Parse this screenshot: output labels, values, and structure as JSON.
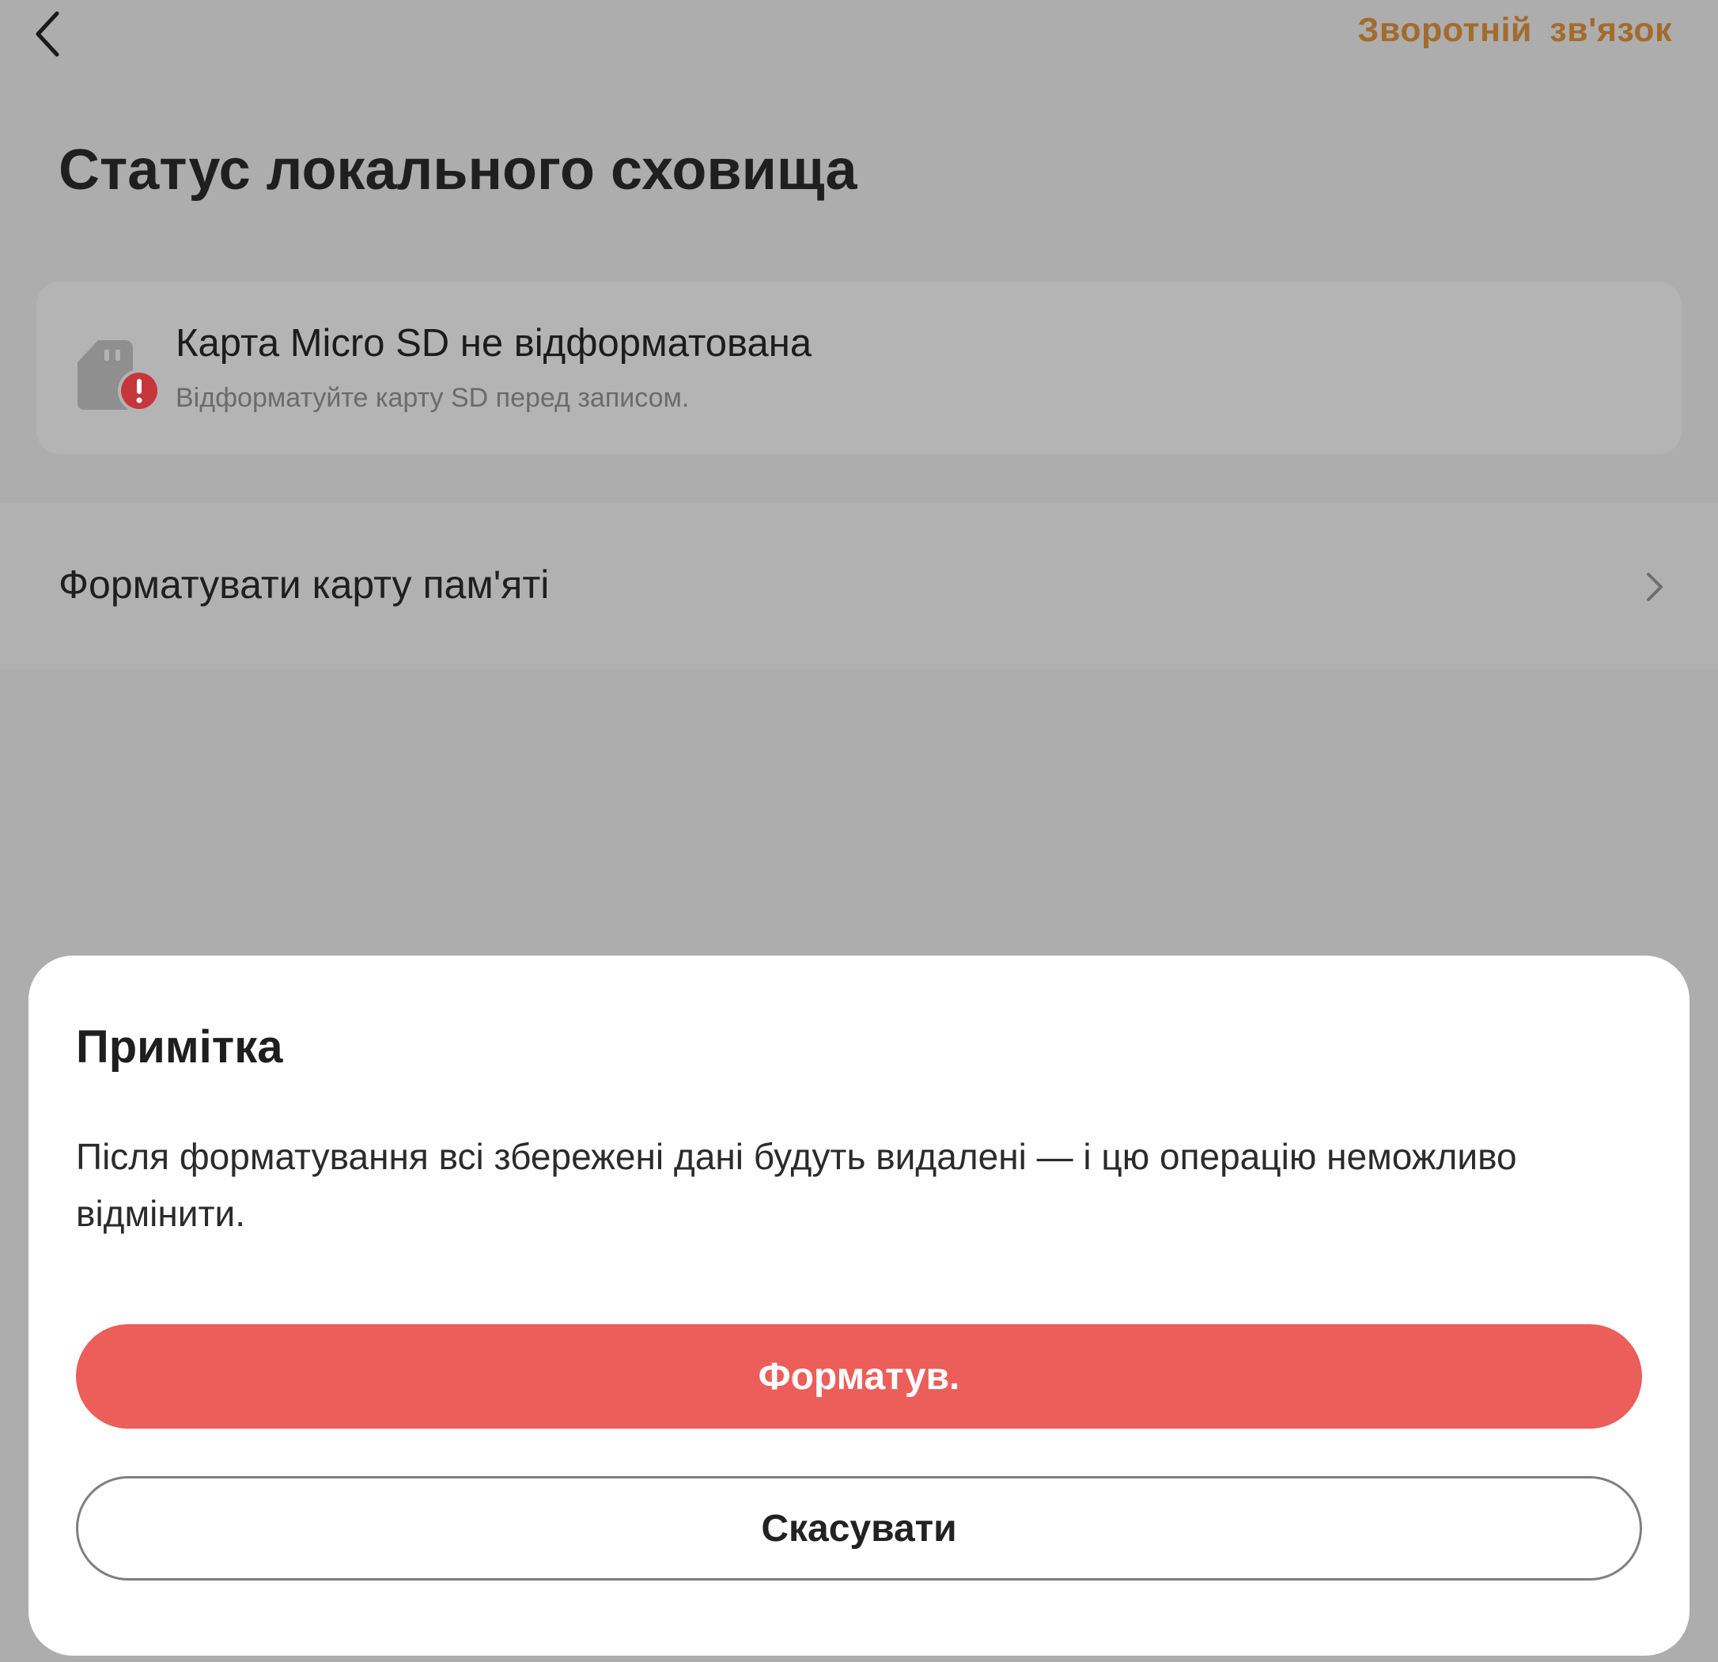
{
  "header": {
    "feedback_label": "Зворотній зв'язок"
  },
  "page": {
    "title": "Статус локального сховища"
  },
  "storage_status": {
    "title": "Карта Micro SD не відформатована",
    "subtitle": "Відформатуйте карту SD перед записом."
  },
  "actions": {
    "format_card_label": "Форматувати карту пам'яті"
  },
  "dialog": {
    "title": "Примітка",
    "message": "Після форматування всі збережені дані будуть видалені — і цю операцію неможливо відмінити.",
    "confirm_label": "Форматув.",
    "cancel_label": "Скасувати"
  },
  "icons": {
    "back": "chevron-left-icon",
    "sd_card": "sd-card-icon",
    "warning": "exclamation-icon",
    "row_chevron": "chevron-right-icon"
  },
  "colors": {
    "accent_link": "#a36b2c",
    "danger_button": "#ec5e59",
    "warning_badge": "#c5373a",
    "overlay_background": "#adadad"
  }
}
